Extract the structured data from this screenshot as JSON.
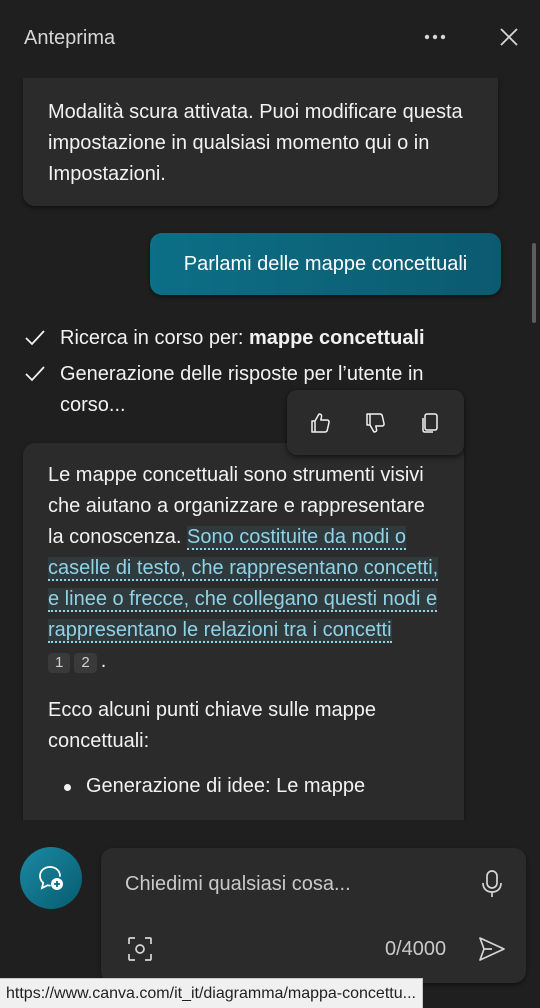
{
  "header": {
    "title": "Anteprima"
  },
  "messages": {
    "notice": "Modalità scura attivata. Puoi modificare questa impostazione in qualsiasi momento qui o in Impostazioni.",
    "user": "Parlami delle mappe concettuali",
    "status1_prefix": "Ricerca in corso per: ",
    "status1_query": "mappe concettuali",
    "status2": "Generazione delle risposte per l’utente in corso...",
    "answer_intro": "Le mappe concettuali sono strumenti visivi che aiutano a organizzare e rappresentare la conoscenza. ",
    "answer_highlight": "Sono costituite da nodi o caselle di testo, che rappresentano concetti, e linee o frecce, che collegano questi nodi e rappresentano le relazioni tra i concetti",
    "citation1": "1",
    "citation2": "2",
    "answer_period": ".",
    "answer_para2": "Ecco alcuni punti chiave sulle mappe concettuali:",
    "bullet1": "Generazione di idee: Le mappe"
  },
  "input": {
    "placeholder": "Chiedimi qualsiasi cosa...",
    "counter": "0/4000"
  },
  "status_url": "https://www.canva.com/it_it/diagramma/mappa-concettu..."
}
